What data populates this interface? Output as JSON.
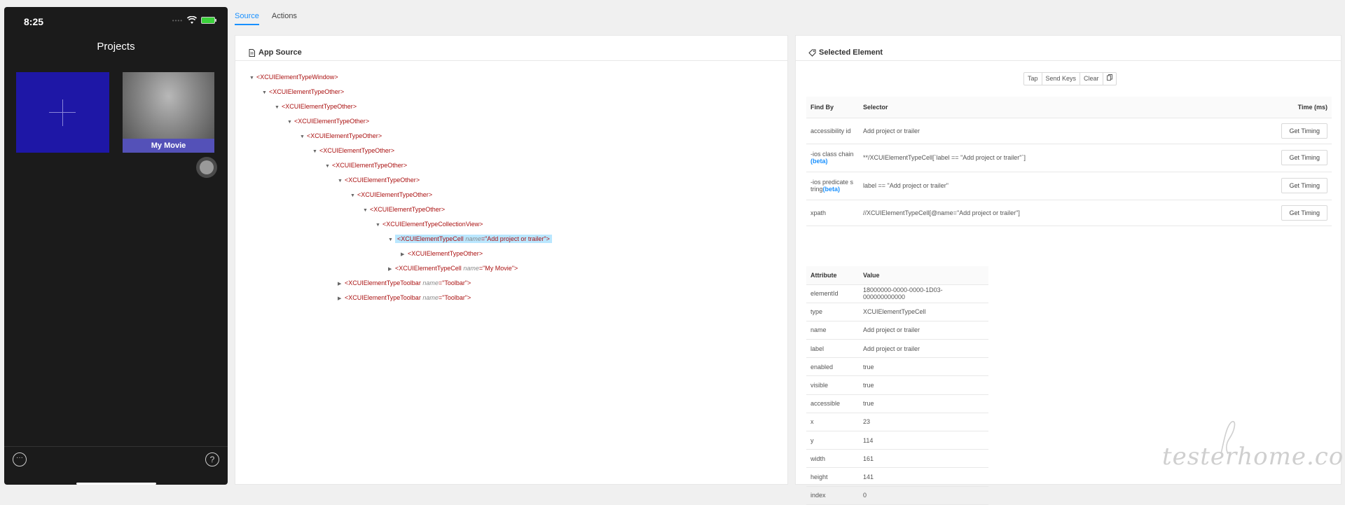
{
  "phone": {
    "time": "8:25",
    "title": "Projects",
    "movie_label": "My Movie",
    "more_icon": "ellipsis-circle-icon",
    "help_icon": "question-circle-icon",
    "help_glyph": "?",
    "more_glyph": "···"
  },
  "tabs": [
    {
      "label": "Source",
      "active": true
    },
    {
      "label": "Actions",
      "active": false
    }
  ],
  "source": {
    "title": "App Source",
    "nodes": [
      {
        "depth": 0,
        "caret": "down",
        "tag": "XCUIElementTypeWindow"
      },
      {
        "depth": 1,
        "caret": "down",
        "tag": "XCUIElementTypeOther"
      },
      {
        "depth": 2,
        "caret": "down",
        "tag": "XCUIElementTypeOther"
      },
      {
        "depth": 3,
        "caret": "down",
        "tag": "XCUIElementTypeOther"
      },
      {
        "depth": 4,
        "caret": "down",
        "tag": "XCUIElementTypeOther"
      },
      {
        "depth": 5,
        "caret": "down",
        "tag": "XCUIElementTypeOther"
      },
      {
        "depth": 6,
        "caret": "down",
        "tag": "XCUIElementTypeOther"
      },
      {
        "depth": 7,
        "caret": "down",
        "tag": "XCUIElementTypeOther"
      },
      {
        "depth": 8,
        "caret": "down",
        "tag": "XCUIElementTypeOther"
      },
      {
        "depth": 9,
        "caret": "down",
        "tag": "XCUIElementTypeOther"
      },
      {
        "depth": 10,
        "caret": "down",
        "tag": "XCUIElementTypeCollectionView"
      },
      {
        "depth": 11,
        "caret": "down",
        "tag": "XCUIElementTypeCell",
        "attr": "name",
        "value": "Add project or trailer",
        "selected": true
      },
      {
        "depth": 12,
        "caret": "right",
        "tag": "XCUIElementTypeOther"
      },
      {
        "depth": 11,
        "caret": "right",
        "tag": "XCUIElementTypeCell",
        "attr": "name",
        "value": "My Movie"
      },
      {
        "depth": 7,
        "caret": "right",
        "tag": "XCUIElementTypeToolbar",
        "attr": "name",
        "value": "Toolbar"
      },
      {
        "depth": 7,
        "caret": "right",
        "tag": "XCUIElementTypeToolbar",
        "attr": "name",
        "value": "Toolbar"
      }
    ]
  },
  "selected": {
    "title": "Selected Element",
    "toolbar": [
      "Tap",
      "Send Keys",
      "Clear"
    ],
    "find_headers": [
      "Find By",
      "Selector",
      "Time (ms)"
    ],
    "find_rows": [
      {
        "by": "accessibility id",
        "beta": "",
        "selector": "Add project or trailer",
        "button": "Get Timing"
      },
      {
        "by": "-ios class chain",
        "beta": "(beta)",
        "selector": "**/XCUIElementTypeCell[`label == \"Add project or trailer\"`]",
        "button": "Get Timing"
      },
      {
        "by": "-ios predicate s tring",
        "beta": "(beta)",
        "selector": "label == \"Add project or trailer\"",
        "button": "Get Timing"
      },
      {
        "by": "xpath",
        "beta": "",
        "selector": "//XCUIElementTypeCell[@name=\"Add project or trailer\"]",
        "button": "Get Timing"
      }
    ],
    "attr_headers": [
      "Attribute",
      "Value"
    ],
    "attributes": [
      {
        "name": "elementId",
        "value": "18000000-0000-0000-1D03-000000000000"
      },
      {
        "name": "type",
        "value": "XCUIElementTypeCell"
      },
      {
        "name": "name",
        "value": "Add project or trailer"
      },
      {
        "name": "label",
        "value": "Add project or trailer"
      },
      {
        "name": "enabled",
        "value": "true"
      },
      {
        "name": "visible",
        "value": "true"
      },
      {
        "name": "accessible",
        "value": "true"
      },
      {
        "name": "x",
        "value": "23"
      },
      {
        "name": "y",
        "value": "114"
      },
      {
        "name": "width",
        "value": "161"
      },
      {
        "name": "height",
        "value": "141"
      },
      {
        "name": "index",
        "value": "0"
      }
    ]
  },
  "watermark": "testerhome.com"
}
